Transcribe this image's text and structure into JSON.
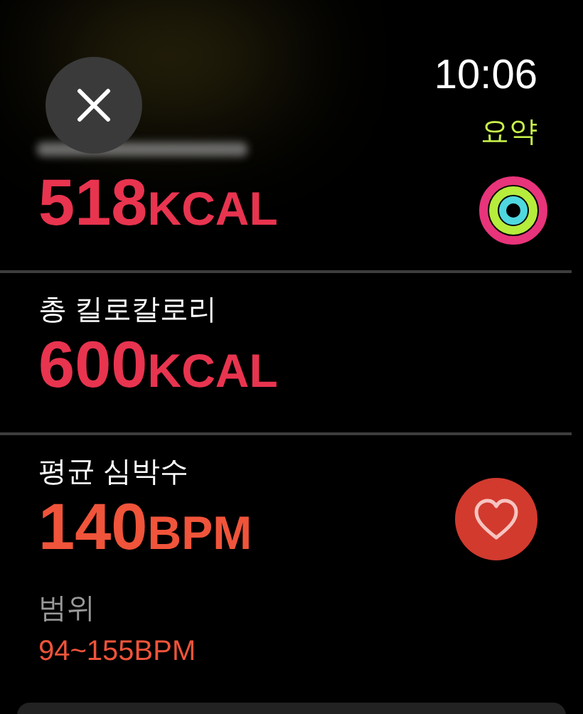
{
  "status_bar": {
    "time": "10:06",
    "page_title": "요약"
  },
  "metrics": [
    {
      "kind": "rings",
      "value": "518",
      "unit": "KCAL",
      "color": "#e8344f"
    },
    {
      "kind": "plain",
      "label": "총 킬로칼로리",
      "value": "600",
      "unit": "KCAL",
      "color": "#e8344f"
    },
    {
      "kind": "heart",
      "label": "평균 심박수",
      "value": "140",
      "unit": "BPM",
      "color": "#f0543a",
      "range_label": "범위",
      "range_value": "94~155BPM"
    }
  ]
}
